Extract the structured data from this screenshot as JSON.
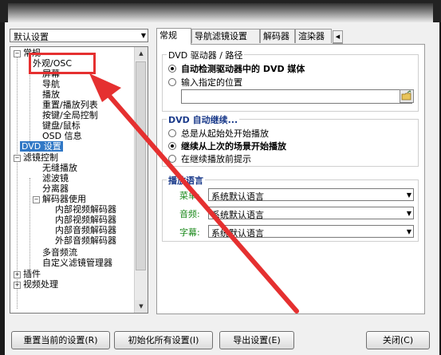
{
  "preset": {
    "value": "默认设置"
  },
  "tree": {
    "items": [
      {
        "label": "常规"
      },
      {
        "label": "外观/OSC"
      },
      {
        "label": "屏幕"
      },
      {
        "label": "导航"
      },
      {
        "label": "播放"
      },
      {
        "label": "重置/播放列表"
      },
      {
        "label": "按键/全局控制"
      },
      {
        "label": "键盘/鼠标"
      },
      {
        "label": "OSD 信息"
      },
      {
        "label": "DVD 设置"
      },
      {
        "label": "滤镜控制"
      },
      {
        "label": "无缝播放"
      },
      {
        "label": "滤波镜"
      },
      {
        "label": "分离器"
      },
      {
        "label": "解码器使用"
      },
      {
        "label": "内部视频解码器"
      },
      {
        "label": "内部视频解码器"
      },
      {
        "label": "内部音频解码器"
      },
      {
        "label": "外部音频解码器"
      },
      {
        "label": "多音频流"
      },
      {
        "label": "自定义滤镜管理器"
      },
      {
        "label": "插件"
      },
      {
        "label": "视频处理"
      }
    ]
  },
  "tabs": [
    {
      "label": "常规"
    },
    {
      "label": "导航滤镜设置"
    },
    {
      "label": "解码器"
    },
    {
      "label": "渲染器"
    }
  ],
  "dvd_drive": {
    "title": "DVD 驱动器 / 路径",
    "option_auto": "自动检测驱动器中的 DVD 媒体",
    "option_manual": "输入指定的位置",
    "path_value": ""
  },
  "dvd_resume": {
    "title": "DVD 自动继续...",
    "option_start": "总是从起始处开始播放",
    "option_last": "继续从上次的场景开始播放",
    "option_prompt": "在继续播放前提示"
  },
  "lang": {
    "title": "播放语言",
    "menu_label": "菜单:",
    "menu_value": "系统默认语言",
    "audio_label": "音频:",
    "audio_value": "系统默认语言",
    "sub_label": "字幕:",
    "sub_value": "系统默认语言"
  },
  "buttons": {
    "reset": "重置当前的设置(R)",
    "init_all": "初始化所有设置(I)",
    "export": "导出设置(E)",
    "close": "关闭(C)"
  },
  "colors": {
    "accent": "#3178c6",
    "arrow": "#e53030",
    "green_label": "#1c8a1c"
  }
}
